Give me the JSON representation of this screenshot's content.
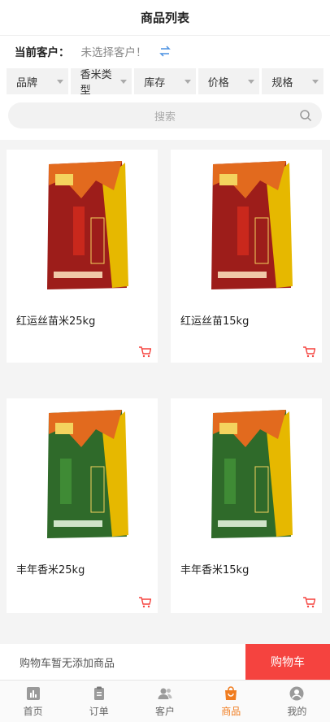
{
  "header": {
    "title": "商品列表"
  },
  "customer": {
    "label": "当前客户：",
    "value": "未选择客户！",
    "switch_icon": "swap-icon"
  },
  "filters": [
    {
      "label": "品牌"
    },
    {
      "label": "香米类型"
    },
    {
      "label": "库存"
    },
    {
      "label": "价格"
    },
    {
      "label": "规格"
    }
  ],
  "search": {
    "placeholder": "搜索"
  },
  "products": [
    {
      "name": "红运丝苗米25kg",
      "bag_color": "#9d1d1a",
      "accent": "#c9281c"
    },
    {
      "name": "红运丝苗15kg",
      "bag_color": "#9d1d1a",
      "accent": "#c9281c"
    },
    {
      "name": "丰年香米25kg",
      "bag_color": "#2f6a2a",
      "accent": "#3f8b35"
    },
    {
      "name": "丰年香米15kg",
      "bag_color": "#2f6a2a",
      "accent": "#3f8b35"
    }
  ],
  "cartbar": {
    "empty_text": "购物车暂无添加商品",
    "button_label": "购物车"
  },
  "tabs": [
    {
      "label": "首页",
      "icon": "home-icon",
      "active": false
    },
    {
      "label": "订单",
      "icon": "order-icon",
      "active": false
    },
    {
      "label": "客户",
      "icon": "customer-icon",
      "active": false
    },
    {
      "label": "商品",
      "icon": "product-bag-icon",
      "active": true
    },
    {
      "label": "我的",
      "icon": "profile-icon",
      "active": false
    }
  ],
  "colors": {
    "accent_red": "#f5433f",
    "active_orange": "#f07c1f"
  }
}
